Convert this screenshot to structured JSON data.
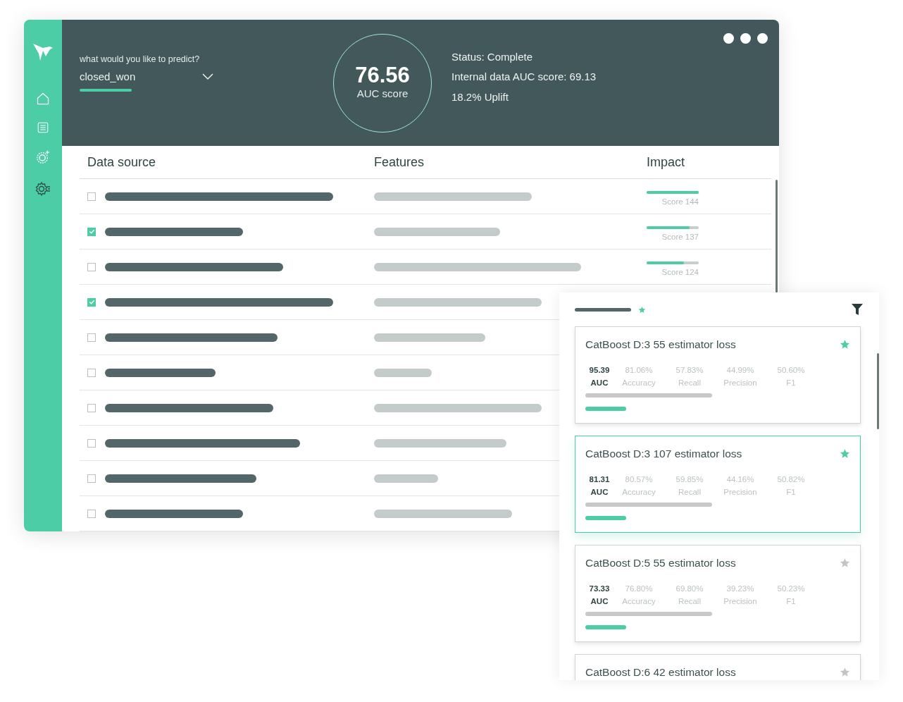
{
  "predict": {
    "label": "what would you like to predict?",
    "value": "closed_won"
  },
  "score": {
    "value": "76.56",
    "label": "AUC score"
  },
  "status_lines": [
    "Status: Complete",
    "Internal data AUC score: 69.13",
    "18.2% Uplift"
  ],
  "table": {
    "columns": [
      "Data source",
      "Features",
      "Impact"
    ],
    "rows": [
      {
        "checked": false,
        "impact": {
          "level": 1,
          "reading": "Score 144"
        }
      },
      {
        "checked": true,
        "impact": {
          "level": 0.83,
          "reading": "Score 137"
        }
      },
      {
        "checked": false,
        "impact": {
          "level": 0.72,
          "reading": "Score 124"
        }
      },
      {
        "checked": true
      },
      {
        "checked": false
      },
      {
        "checked": false
      },
      {
        "checked": false
      },
      {
        "checked": false
      },
      {
        "checked": false
      },
      {
        "checked": false
      }
    ]
  },
  "models": {
    "cards": [
      {
        "title": "CatBoost D:3 55 estimator loss",
        "starred": true,
        "selected": false,
        "metrics": [
          {
            "kind": "primary",
            "value": "95.39",
            "label": "AUC"
          },
          {
            "kind": "secondary",
            "value": "81.06%",
            "label": "Accuracy"
          },
          {
            "kind": "secondary",
            "value": "57.83%",
            "label": "Recall"
          },
          {
            "kind": "secondary",
            "value": "44.99%",
            "label": "Precision"
          },
          {
            "kind": "secondary",
            "value": "50.60%",
            "label": "F1"
          }
        ]
      },
      {
        "title": "CatBoost D:3 107 estimator loss",
        "starred": true,
        "selected": true,
        "metrics": [
          {
            "kind": "primary",
            "value": "81.31",
            "label": "AUC"
          },
          {
            "kind": "secondary",
            "value": "80.57%",
            "label": "Accuracy"
          },
          {
            "kind": "secondary",
            "value": "59.85%",
            "label": "Recall"
          },
          {
            "kind": "secondary",
            "value": "44.16%",
            "label": "Precision"
          },
          {
            "kind": "secondary",
            "value": "50.82%",
            "label": "F1"
          }
        ]
      },
      {
        "title": "CatBoost D:5 55 estimator loss",
        "starred": false,
        "selected": false,
        "metrics": [
          {
            "kind": "primary",
            "value": "73.33",
            "label": "AUC"
          },
          {
            "kind": "secondary",
            "value": "76.80%",
            "label": "Accuracy"
          },
          {
            "kind": "secondary",
            "value": "69.80%",
            "label": "Recall"
          },
          {
            "kind": "secondary",
            "value": "39.23%",
            "label": "Precision"
          },
          {
            "kind": "secondary",
            "value": "50.23%",
            "label": "F1"
          }
        ]
      },
      {
        "title": "CatBoost D:6 42 estimator loss",
        "starred": false,
        "selected": false
      }
    ]
  }
}
